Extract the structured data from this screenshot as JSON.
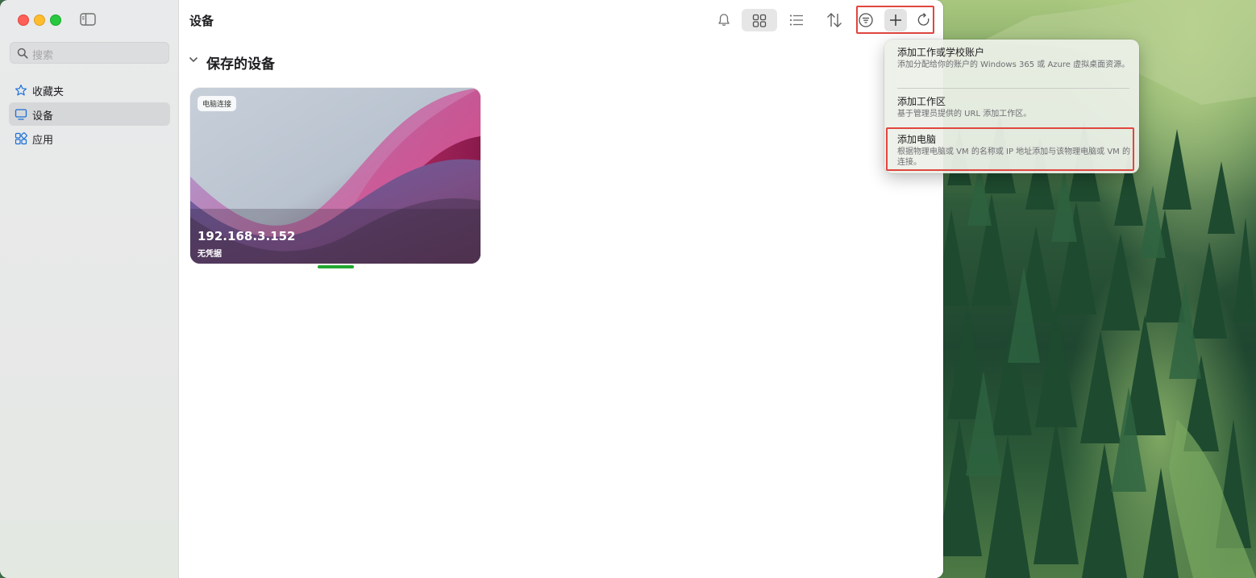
{
  "window": {
    "title": "设备"
  },
  "sidebar": {
    "search_placeholder": "搜索",
    "items": [
      {
        "label": "收藏夹",
        "icon": "star-icon",
        "active": false
      },
      {
        "label": "设备",
        "icon": "monitor-icon",
        "active": true
      },
      {
        "label": "应用",
        "icon": "apps-icon",
        "active": false
      }
    ]
  },
  "toolbar": {
    "icons": [
      "bell-icon",
      "grid-view-icon",
      "list-view-icon",
      "sort-icon",
      "filter-icon",
      "plus-icon",
      "refresh-icon"
    ],
    "grid_view_selected": true
  },
  "main": {
    "section_title": "保存的设备",
    "device": {
      "badge": "电脑连接",
      "name": "192.168.3.152",
      "status": "无凭据"
    }
  },
  "add_menu": {
    "items": [
      {
        "title": "添加工作或学校账户",
        "desc": "添加分配给你的账户的 Windows 365 或 Azure 虚拟桌面资源。"
      },
      {
        "title": "添加工作区",
        "desc": "基于管理员提供的 URL 添加工作区。"
      },
      {
        "title": "添加电脑",
        "desc": "根据物理电脑或 VM 的名称或 IP 地址添加与该物理电脑或 VM 的连接。"
      }
    ]
  },
  "colors": {
    "highlight": "#e0463f",
    "status_indicator": "#22a732",
    "accent": "#1a6fd6"
  }
}
